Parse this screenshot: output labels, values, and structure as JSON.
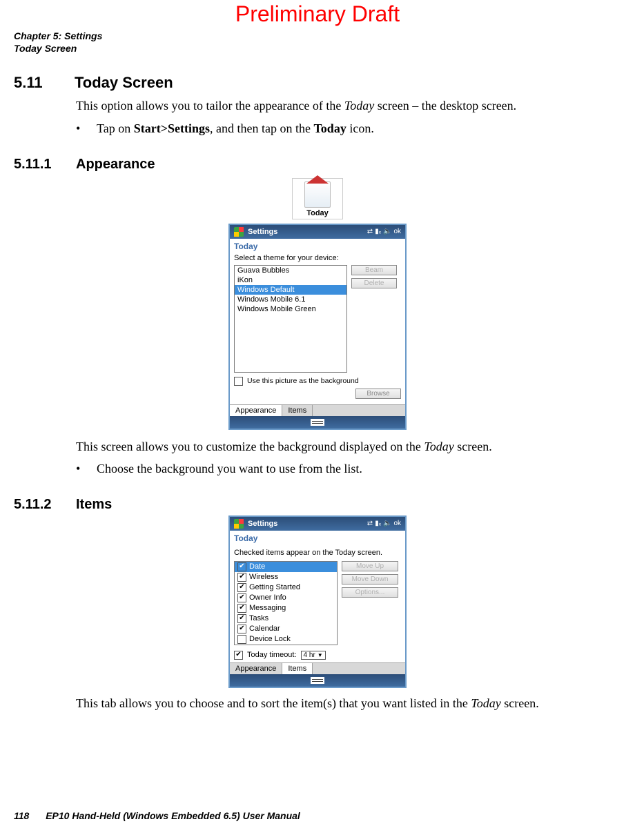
{
  "draft": "Preliminary Draft",
  "chapter_line1": "Chapter 5: Settings",
  "chapter_line2": "Today Screen",
  "section": {
    "num": "5.11",
    "title": "Today Screen"
  },
  "intro_pre": "This option allows you to tailor the appearance of the ",
  "intro_em": "Today",
  "intro_post": " screen – the desktop screen.",
  "bullet1_pre": "Tap on ",
  "bullet1_b1": "Start>Settings",
  "bullet1_mid": ", and then tap on the ",
  "bullet1_b2": "Today",
  "bullet1_end": " icon.",
  "sub1": {
    "num": "5.11.1",
    "title": "Appearance"
  },
  "today_icon_label": "Today",
  "screen1": {
    "header": "Settings",
    "ok": "ok",
    "subtitle": "Today",
    "select_label": "Select a theme for your device:",
    "themes": [
      "Guava Bubbles",
      "iKon",
      "Windows Default",
      "Windows Mobile 6.1",
      "Windows Mobile Green"
    ],
    "beam": "Beam",
    "delete": "Delete",
    "bg_checkbox": "Use this picture as the background",
    "browse": "Browse",
    "tabs": [
      "Appearance",
      "Items"
    ]
  },
  "appearance_desc_pre": "This screen allows you to customize the background displayed on the ",
  "appearance_desc_em": "Today",
  "appearance_desc_post": " screen.",
  "appearance_bullet": "Choose the background you want to use from the list.",
  "sub2": {
    "num": "5.11.2",
    "title": "Items"
  },
  "screen2": {
    "header": "Settings",
    "ok": "ok",
    "subtitle": "Today",
    "label": "Checked items appear on the Today screen.",
    "items": [
      {
        "label": "Date",
        "checked": true,
        "highlight": true
      },
      {
        "label": "Wireless",
        "checked": true
      },
      {
        "label": "Getting Started",
        "checked": true
      },
      {
        "label": "Owner Info",
        "checked": true
      },
      {
        "label": "Messaging",
        "checked": true
      },
      {
        "label": "Tasks",
        "checked": true
      },
      {
        "label": "Calendar",
        "checked": true
      },
      {
        "label": "Device Lock",
        "checked": false
      }
    ],
    "moveup": "Move Up",
    "movedown": "Move Down",
    "options": "Options...",
    "timeout_label": "Today timeout:",
    "timeout_value": "4 hr",
    "tabs": [
      "Appearance",
      "Items"
    ]
  },
  "items_desc_pre": "This tab allows you to choose and to sort the item(s) that you want listed in the ",
  "items_desc_em": "Today",
  "items_desc_post": " screen.",
  "footer": {
    "page": "118",
    "doc": "EP10 Hand-Held (Windows Embedded 6.5) User Manual"
  }
}
